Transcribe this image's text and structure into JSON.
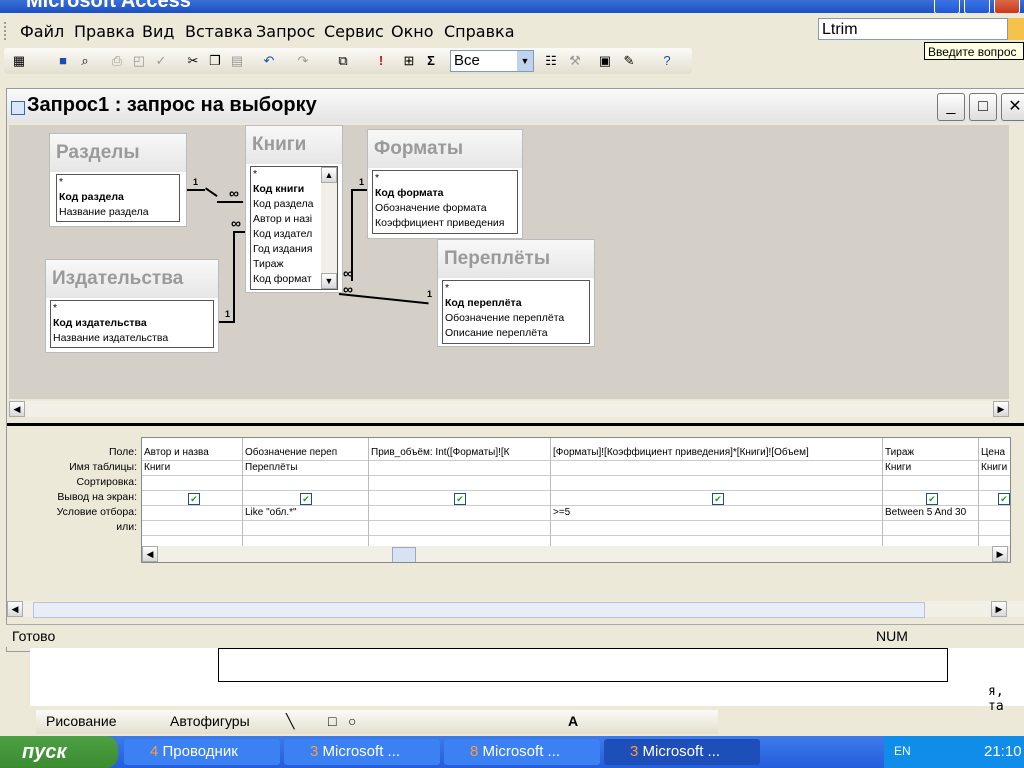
{
  "app": {
    "title": "Microsoft Access"
  },
  "menu": [
    "Файл",
    "Правка",
    "Вид",
    "Вставка",
    "Запрос",
    "Сервис",
    "Окно",
    "Справка"
  ],
  "help": {
    "value": "Ltrim",
    "tip": "Введите вопрос"
  },
  "toolbar": {
    "combo_value": "Все"
  },
  "query_window": {
    "title": "Запрос1 : запрос на выборку"
  },
  "tables": [
    {
      "name": "Разделы",
      "fields": [
        "*",
        "Код раздела",
        "Название раздела"
      ]
    },
    {
      "name": "Книги",
      "fields": [
        "*",
        "Код книги",
        "Код раздела",
        "Автор и назі",
        "Код издател",
        "Год издания",
        "Тираж",
        "Код формат"
      ]
    },
    {
      "name": "Форматы",
      "fields": [
        "*",
        "Код формата",
        "Обозначение формата",
        "Коэффициент приведения"
      ]
    },
    {
      "name": "Издательства",
      "fields": [
        "*",
        "Код издательства",
        "Название издательства"
      ]
    },
    {
      "name": "Переплёты",
      "fields": [
        "*",
        "Код переплёта",
        "Обозначение переплёта",
        "Описание переплёта"
      ]
    }
  ],
  "relations": {
    "one": "1",
    "many": "∞"
  },
  "grid": {
    "row_labels": [
      "Поле:",
      "Имя таблицы:",
      "Сортировка:",
      "Вывод на экран:",
      "Условие отбора:",
      "или:"
    ],
    "columns": [
      {
        "field": "Автор и назва",
        "table": "Книги",
        "show": true,
        "criteria": ""
      },
      {
        "field": "Обозначение переп",
        "table": "Переплёты",
        "show": true,
        "criteria": "Like \"обл.*\""
      },
      {
        "field": "Прив_объём: Int([Форматы]![К",
        "table": "",
        "show": true,
        "criteria": ""
      },
      {
        "field": "[Форматы]![Коэффициент приведения]*[Книги]![Объем]",
        "table": "",
        "show": true,
        "criteria": ">=5"
      },
      {
        "field": "Тираж",
        "table": "Книги",
        "show": true,
        "criteria": "Between 5 And 30"
      },
      {
        "field": "Цена",
        "table": "Книги",
        "show": true,
        "criteria": ""
      }
    ]
  },
  "status": {
    "left": "Готово",
    "right": "NUM"
  },
  "word": {
    "side_text": "я, та",
    "draw": "Рисование",
    "autoshapes": "Автофигуры"
  },
  "taskbar": {
    "start": "пуск",
    "tasks": [
      {
        "num": "4",
        "label": "Проводник"
      },
      {
        "num": "3",
        "label": "Microsoft ..."
      },
      {
        "num": "8",
        "label": "Microsoft ..."
      },
      {
        "num": "3",
        "label": "Microsoft ..."
      }
    ],
    "lang": "EN",
    "clock": "21:10"
  }
}
